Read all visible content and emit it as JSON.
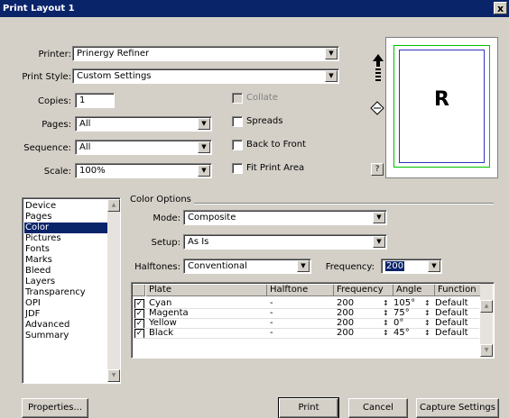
{
  "window": {
    "title": "Print Layout 1",
    "close_label": "x"
  },
  "form": {
    "printer": {
      "label": "Printer:",
      "value": "Prinergy Refiner"
    },
    "print_style": {
      "label": "Print Style:",
      "value": "Custom Settings"
    },
    "copies": {
      "label": "Copies:",
      "value": "1"
    },
    "pages": {
      "label": "Pages:",
      "value": "All"
    },
    "sequence": {
      "label": "Sequence:",
      "value": "All"
    },
    "scale": {
      "label": "Scale:",
      "value": "100%"
    },
    "collate": {
      "label": "Collate",
      "checked": false
    },
    "spreads": {
      "label": "Spreads",
      "checked": false
    },
    "back_to_front": {
      "label": "Back to Front",
      "checked": false
    },
    "fit_print_area": {
      "label": "Fit Print Area",
      "checked": false
    }
  },
  "preview": {
    "letter": "R",
    "help_label": "?"
  },
  "sidebar": {
    "items": [
      "Device",
      "Pages",
      "Color",
      "Pictures",
      "Fonts",
      "Marks",
      "Bleed",
      "Layers",
      "Transparency",
      "OPI",
      "JDF",
      "Advanced",
      "Summary"
    ],
    "selected": "Color"
  },
  "color_options": {
    "title": "Color Options",
    "mode": {
      "label": "Mode:",
      "value": "Composite"
    },
    "setup": {
      "label": "Setup:",
      "value": "As Is"
    },
    "halftones": {
      "label": "Halftones:",
      "value": "Conventional"
    },
    "frequency": {
      "label": "Frequency:",
      "value": "200"
    }
  },
  "plates_table": {
    "columns": [
      "Plate",
      "Halftone",
      "Frequency",
      "Angle",
      "Function"
    ],
    "rows": [
      {
        "plate": "Cyan",
        "halftone": "-",
        "frequency": "200",
        "angle": "105°",
        "function": "Default"
      },
      {
        "plate": "Magenta",
        "halftone": "-",
        "frequency": "200",
        "angle": "75°",
        "function": "Default"
      },
      {
        "plate": "Yellow",
        "halftone": "-",
        "frequency": "200",
        "angle": "0°",
        "function": "Default"
      },
      {
        "plate": "Black",
        "halftone": "-",
        "frequency": "200",
        "angle": "45°",
        "function": "Default"
      }
    ]
  },
  "buttons": {
    "properties": "Properties...",
    "print": "Print",
    "cancel": "Cancel",
    "capture": "Capture Settings"
  }
}
